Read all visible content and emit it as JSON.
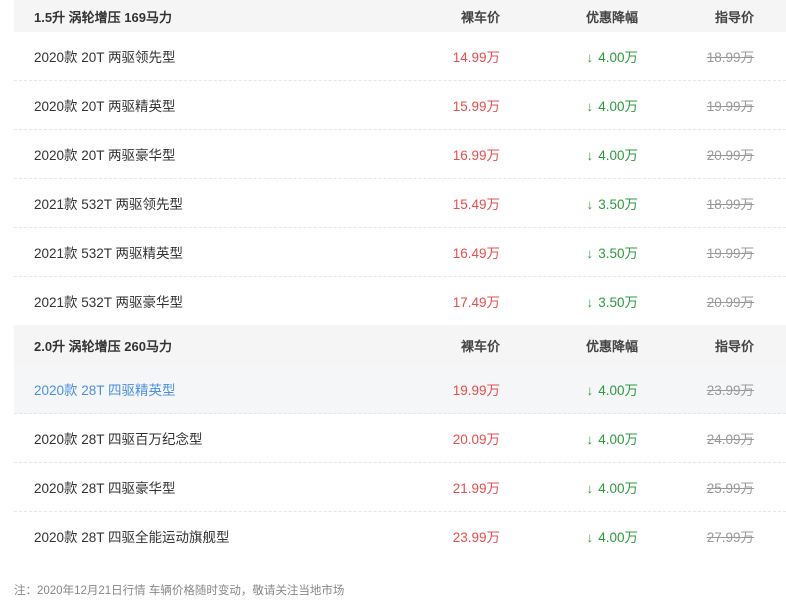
{
  "groups": [
    {
      "header": {
        "engine": "1.5升 涡轮增压 169马力",
        "col_price": "裸车价",
        "col_discount": "优惠降幅",
        "col_guide": "指导价"
      },
      "rows": [
        {
          "name": "2020款 20T 两驱领先型",
          "price": "14.99万",
          "discount": "4.00万",
          "guide": "18.99万"
        },
        {
          "name": "2020款 20T 两驱精英型",
          "price": "15.99万",
          "discount": "4.00万",
          "guide": "19.99万"
        },
        {
          "name": "2020款 20T 两驱豪华型",
          "price": "16.99万",
          "discount": "4.00万",
          "guide": "20.99万"
        },
        {
          "name": "2021款 532T 两驱领先型",
          "price": "15.49万",
          "discount": "3.50万",
          "guide": "18.99万"
        },
        {
          "name": "2021款 532T 两驱精英型",
          "price": "16.49万",
          "discount": "3.50万",
          "guide": "19.99万"
        },
        {
          "name": "2021款 532T 两驱豪华型",
          "price": "17.49万",
          "discount": "3.50万",
          "guide": "20.99万"
        }
      ]
    },
    {
      "header": {
        "engine": "2.0升 涡轮增压 260马力",
        "col_price": "裸车价",
        "col_discount": "优惠降幅",
        "col_guide": "指导价"
      },
      "rows": [
        {
          "name": "2020款 28T 四驱精英型",
          "price": "19.99万",
          "discount": "4.00万",
          "guide": "23.99万"
        },
        {
          "name": "2020款 28T 四驱百万纪念型",
          "price": "20.09万",
          "discount": "4.00万",
          "guide": "24.09万"
        },
        {
          "name": "2020款 28T 四驱豪华型",
          "price": "21.99万",
          "discount": "4.00万",
          "guide": "25.99万"
        },
        {
          "name": "2020款 28T 四驱全能运动旗舰型",
          "price": "23.99万",
          "discount": "4.00万",
          "guide": "27.99万"
        }
      ]
    }
  ],
  "arrow_symbol": "↓",
  "footer_note": "注：2020年12月21日行情 车辆价格随时变动，敬请关注当地市场",
  "colors": {
    "price": "#e84d4d",
    "discount": "#2c9a3c",
    "guide": "#999999",
    "link": "#4a90e2",
    "header_bg": "#f5f5f5"
  }
}
